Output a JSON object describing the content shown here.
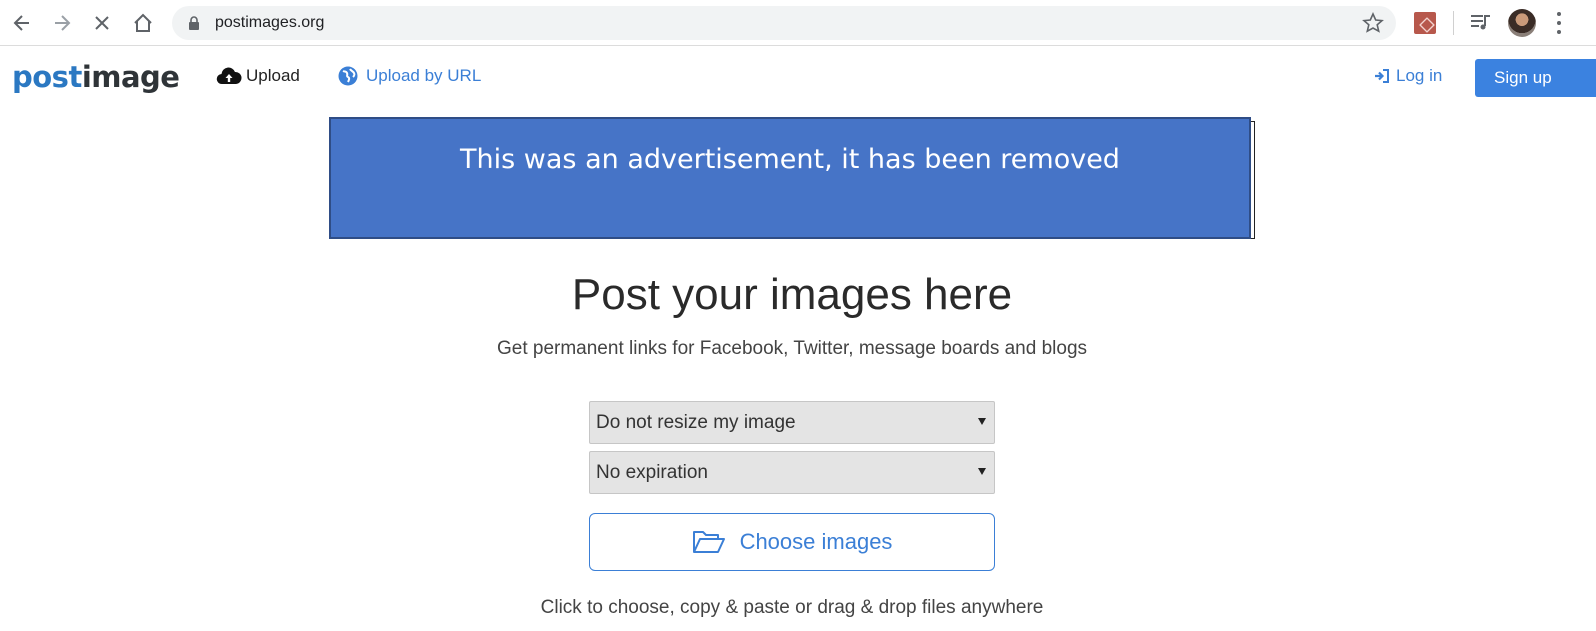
{
  "browser": {
    "url": "postimages.org"
  },
  "header": {
    "logo_part1": "post",
    "logo_part2": "image",
    "upload_label": "Upload",
    "upload_by_url_label": "Upload by URL",
    "login_label": "Log in",
    "signup_label": "Sign up"
  },
  "ad": {
    "text": "This was an advertisement, it has been removed"
  },
  "main": {
    "headline": "Post your images here",
    "subline": "Get permanent links for Facebook, Twitter, message boards and blogs",
    "resize_select": {
      "value": "Do not resize my image"
    },
    "expiration_select": {
      "value": "No expiration"
    },
    "choose_button": "Choose images",
    "hint": "Click to choose, copy & paste or drag & drop files anywhere"
  },
  "colors": {
    "brand_blue": "#2b78c2",
    "link_blue": "#3b7fd6",
    "signup_bg": "#3b82e0",
    "ad_bg": "#4674c7"
  },
  "icons": [
    "back-arrow-icon",
    "forward-arrow-icon",
    "stop-icon",
    "home-icon",
    "lock-icon",
    "star-icon",
    "pdf-extension-icon",
    "queue-icon",
    "avatar",
    "menu-icon",
    "cloud-upload-icon",
    "globe-icon",
    "sign-in-icon",
    "folder-open-icon"
  ]
}
